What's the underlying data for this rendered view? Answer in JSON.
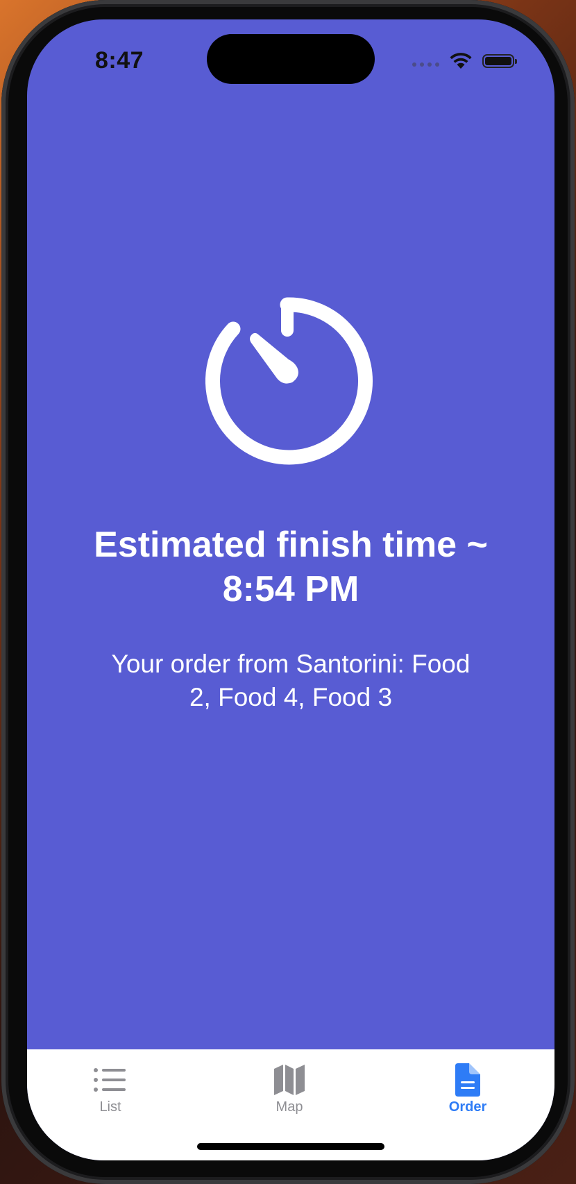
{
  "status_bar": {
    "time": "8:47"
  },
  "main": {
    "icon": "timer-icon",
    "eta_title": "Estimated finish time ~ 8:54 PM",
    "order_summary": "Your order from Santorini: Food 2, Food 4, Food 3"
  },
  "tab_bar": {
    "tabs": [
      {
        "label": "List",
        "icon": "list-icon",
        "active": false
      },
      {
        "label": "Map",
        "icon": "map-icon",
        "active": false
      },
      {
        "label": "Order",
        "icon": "document-icon",
        "active": true
      }
    ]
  },
  "colors": {
    "background": "#585cd3",
    "tab_active": "#2e7cf6",
    "tab_inactive": "#8e8e93",
    "text": "#ffffff"
  }
}
